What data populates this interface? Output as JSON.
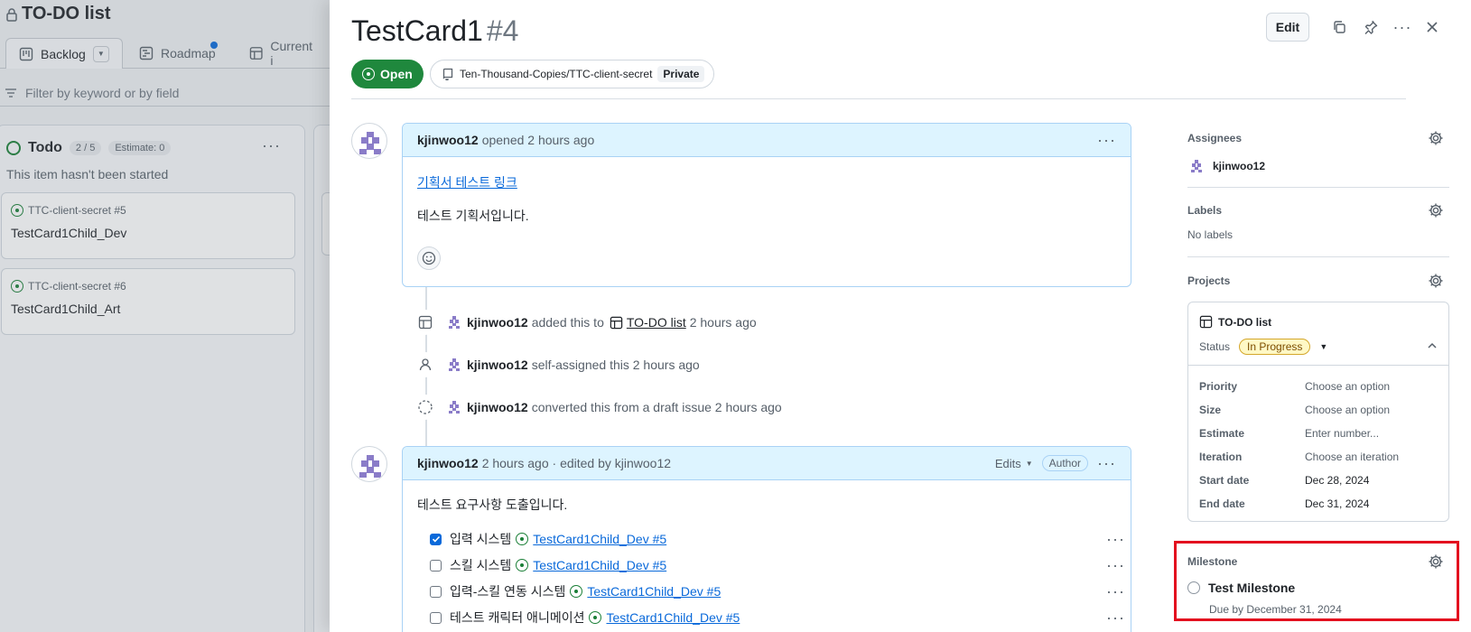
{
  "board": {
    "title": "TO-DO list",
    "tabs": [
      {
        "label": "Backlog"
      },
      {
        "label": "Roadmap"
      },
      {
        "label": "Current i"
      }
    ],
    "filter_placeholder": "Filter by keyword or by field",
    "column": {
      "name": "Todo",
      "count": "2 / 5",
      "estimate": "Estimate: 0",
      "subtitle": "This item hasn't been started",
      "cards": [
        {
          "ref": "TTC-client-secret #5",
          "name": "TestCard1Child_Dev"
        },
        {
          "ref": "TTC-client-secret #6",
          "name": "TestCard1Child_Art"
        }
      ]
    }
  },
  "issue": {
    "title": "TestCard1",
    "number": "#4",
    "edit_label": "Edit",
    "state": "Open",
    "repo": "Ten-Thousand-Copies/TTC-client-secret",
    "visibility": "Private"
  },
  "comment1": {
    "author": "kjinwoo12",
    "meta": "opened 2 hours ago",
    "link_text": "기획서 테스트 링크",
    "body": "테스트 기획서입니다."
  },
  "events": [
    {
      "user": "kjinwoo12",
      "text": "added this to",
      "link": "TO-DO list",
      "time": "2 hours ago"
    },
    {
      "user": "kjinwoo12",
      "text": "self-assigned this 2 hours ago"
    },
    {
      "user": "kjinwoo12",
      "text": "converted this from a draft issue 2 hours ago"
    }
  ],
  "comment2": {
    "author": "kjinwoo12",
    "meta": "2 hours ago · edited by kjinwoo12",
    "edits_label": "Edits",
    "author_badge": "Author",
    "body": "테스트 요구사항 도출입니다.",
    "tasks": [
      {
        "label": "입력 시스템",
        "link": "TestCard1Child_Dev #5",
        "checked": true
      },
      {
        "label": "스킬 시스템",
        "link": "TestCard1Child_Dev #5",
        "checked": false
      },
      {
        "label": "입력-스킬 연동 시스템",
        "link": "TestCard1Child_Dev #5",
        "checked": false
      },
      {
        "label": "테스트 캐릭터 애니메이션",
        "link": "TestCard1Child_Dev #5",
        "checked": false
      }
    ]
  },
  "sidebar": {
    "assignees": {
      "heading": "Assignees",
      "user": "kjinwoo12"
    },
    "labels": {
      "heading": "Labels",
      "value": "No labels"
    },
    "projects": {
      "heading": "Projects",
      "name": "TO-DO list",
      "status_label": "Status",
      "status_value": "In Progress",
      "fields": [
        {
          "key": "Priority",
          "value": "Choose an option"
        },
        {
          "key": "Size",
          "value": "Choose an option"
        },
        {
          "key": "Estimate",
          "value": "Enter number..."
        },
        {
          "key": "Iteration",
          "value": "Choose an iteration"
        },
        {
          "key": "Start date",
          "value": "Dec 28, 2024"
        },
        {
          "key": "End date",
          "value": "Dec 31, 2024"
        }
      ]
    },
    "milestone": {
      "heading": "Milestone",
      "title": "Test Milestone",
      "due": "Due by December 31, 2024"
    }
  },
  "colors": {
    "open_green": "#1f883d",
    "link_blue": "#0969da",
    "comment_header": "#ddf4ff",
    "status_yellow": "#fff8c5",
    "highlight_red": "#e3101f",
    "avatar_purple": "#8a7cc8"
  },
  "icons": [
    "lock-icon",
    "board-icon",
    "roadmap-icon",
    "table-icon",
    "filter-icon",
    "copy-icon",
    "pin-icon",
    "kebab-icon",
    "close-icon",
    "repo-icon",
    "gear-icon",
    "smiley-icon",
    "person-icon",
    "draft-icon",
    "chevron-up-icon",
    "triangle-down-icon",
    "milestone-icon"
  ]
}
